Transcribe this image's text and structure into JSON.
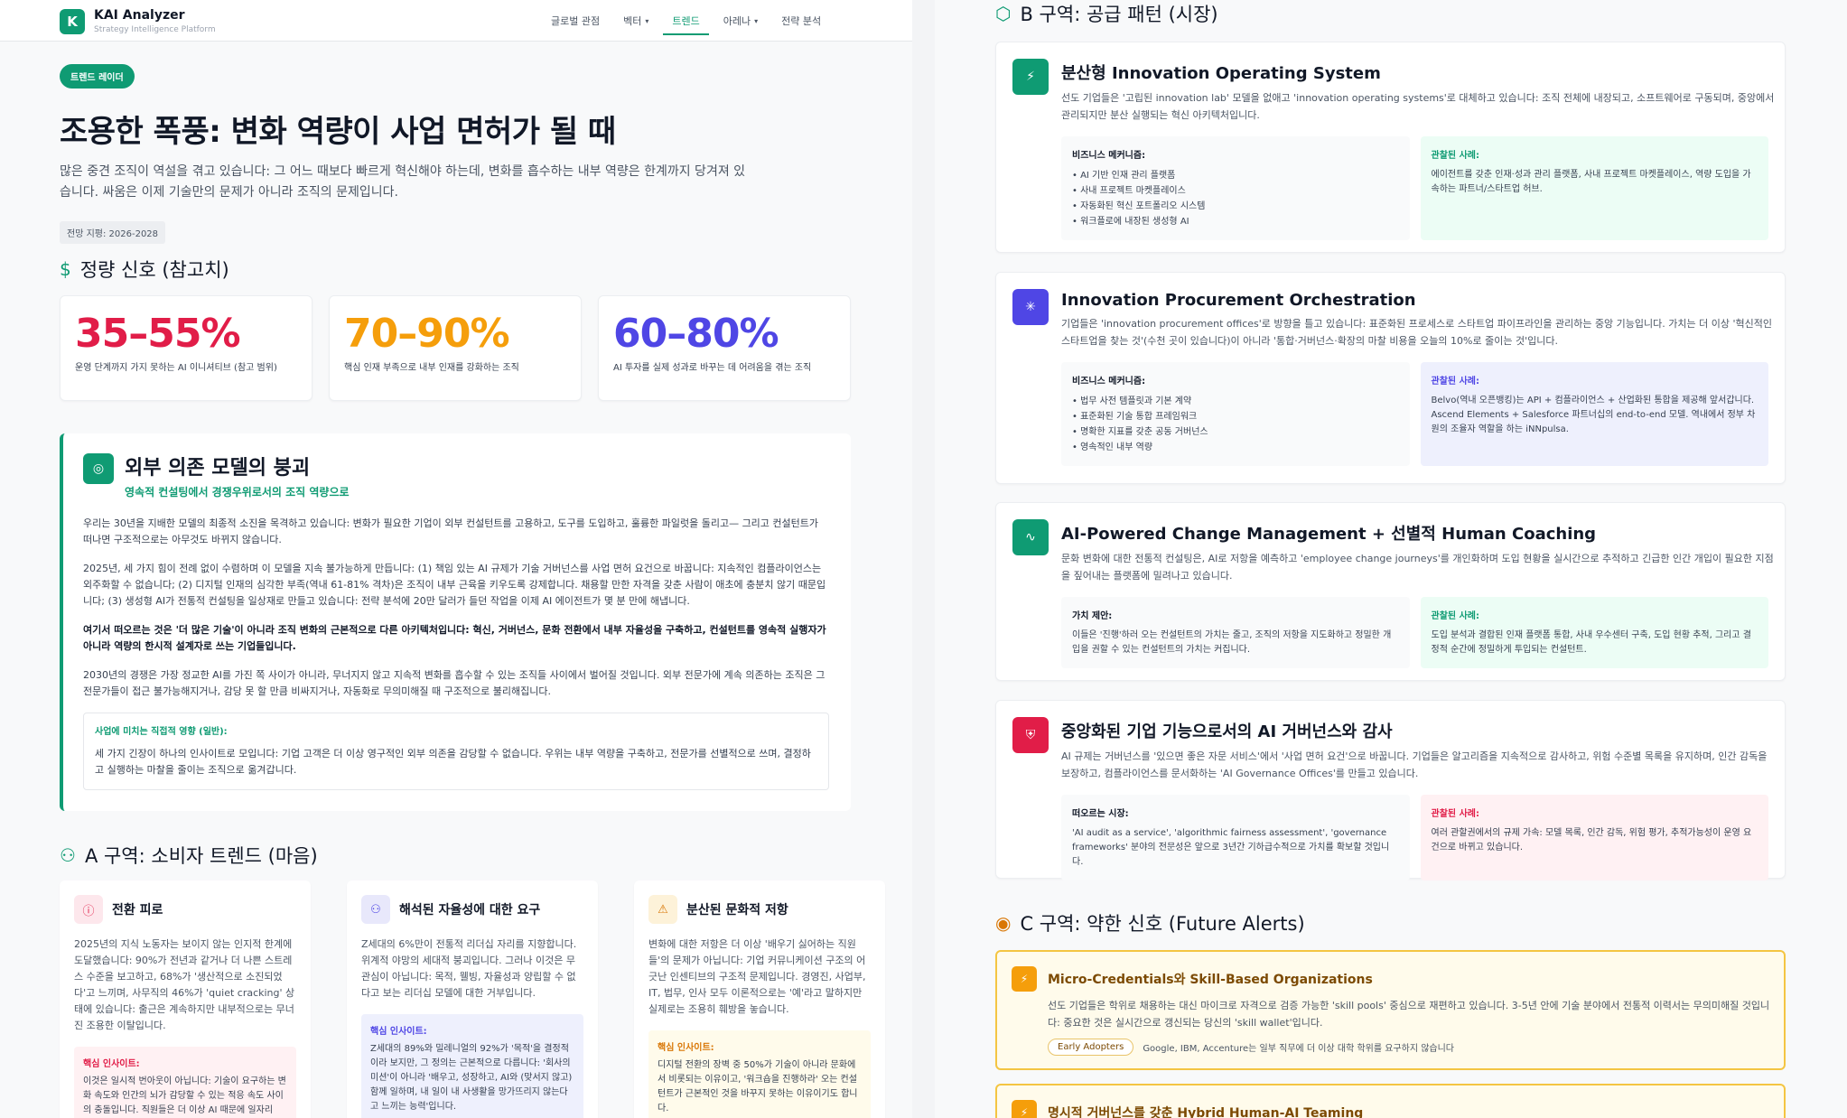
{
  "app": {
    "logo_letter": "K",
    "title": "KAI Analyzer",
    "subtitle": "Strategy Intelligence Platform"
  },
  "nav": {
    "items": [
      {
        "label": "글로벌 관점",
        "dropdown": false,
        "active": false
      },
      {
        "label": "벡터",
        "dropdown": true,
        "active": false
      },
      {
        "label": "트렌드",
        "dropdown": false,
        "active": true
      },
      {
        "label": "아레나",
        "dropdown": true,
        "active": false
      },
      {
        "label": "전략 분석",
        "dropdown": false,
        "active": false
      }
    ]
  },
  "hero": {
    "badge": "트렌드 레이더",
    "title": "조용한 폭풍: 변화 역량이 사업 면허가 될 때",
    "description": "많은 중견 조직이 역설을 겪고 있습니다: 그 어느 때보다 빠르게 혁신해야 하는데, 변화를 흡수하는 내부 역량은 한계까지 당겨져 있습니다. 싸움은 이제 기술만의 문제가 아니라 조직의 문제입니다.",
    "horizon": "전망 지평: 2026-2028"
  },
  "quant": {
    "heading": "정량 신호 (참고치)",
    "metrics": [
      {
        "value": "35–55%",
        "label": "운영 단계까지 가지 못하는 AI 이니셔티브 (참고 범위)",
        "color": "#e11d48"
      },
      {
        "value": "70–90%",
        "label": "핵심 인재 부족으로 내부 인재를 강화하는 조직",
        "color": "#f59e0b"
      },
      {
        "value": "60–80%",
        "label": "AI 투자를 실제 성과로 바꾸는 데 어려움을 겪는 조직",
        "color": "#4f46e5"
      }
    ]
  },
  "collapse": {
    "title": "외부 의존 모델의 붕괴",
    "subtitle": "영속적 컨설팅에서 경쟁우위로서의 조직 역량으로",
    "p1": "우리는 30년을 지배한 모델의 최종적 소진을 목격하고 있습니다: 변화가 필요한 기업이 외부 컨설턴트를 고용하고, 도구를 도입하고, 훌륭한 파일럿을 돌리고— 그리고 컨설턴트가 떠나면 구조적으로는 아무것도 바뀌지 않습니다.",
    "p2": "2025년, 세 가지 힘이 전례 없이 수렴하며 이 모델을 지속 불가능하게 만듭니다: (1) 책임 있는 AI 규제가 기술 거버넌스를 사업 면허 요건으로 바꿉니다: 지속적인 컴플라이언스는 외주화할 수 없습니다; (2) 디지털 인재의 심각한 부족(역내 61-81% 격차)은 조직이 내부 근육을 키우도록 강제합니다. 채용할 만한 자격을 갖춘 사람이 애초에 충분치 않기 때문입니다; (3) 생성형 AI가 전통적 컨설팅을 일상재로 만들고 있습니다: 전략 분석에 20만 달러가 들던 작업을 이제 AI 에이전트가 몇 분 만에 해냅니다.",
    "p3": "여기서 떠오르는 것은 '더 많은 기술'이 아니라 조직 변화의 근본적으로 다른 아키텍처입니다: 혁신, 거버넌스, 문화 전환에서 내부 자율성을 구축하고, 컨설턴트를 영속적 실행자가 아니라 역량의 한시적 설계자로 쓰는 기업들입니다.",
    "p4": "2030년의 경쟁은 가장 정교한 AI를 가진 쪽 사이가 아니라, 무너지지 않고 지속적 변화를 흡수할 수 있는 조직들 사이에서 벌어질 것입니다. 외부 전문가에 계속 의존하는 조직은 그 전문가들이 접근 불가능해지거나, 감당 못 할 만큼 비싸지거나, 자동화로 무의미해질 때 구조적으로 불리해집니다.",
    "impact_title": "사업에 미치는 직접적 영향 (일반):",
    "impact_desc": "세 가지 긴장이 하나의 인사이트로 모입니다: 기업 고객은 더 이상 영구적인 외부 의존을 감당할 수 없습니다. 우위는 내부 역량을 구축하고, 전문가를 선별적으로 쓰며, 결정하고 실행하는 마찰을 줄이는 조직으로 옮겨갑니다."
  },
  "zone_a": {
    "heading": "A 구역: 소비자 트렌드 (마음)",
    "cards": [
      {
        "icon": "alert-circle-icon",
        "title": "전환 피로",
        "desc": "2025년의 지식 노동자는 보이지 않는 인지적 한계에 도달했습니다: 90%가 전년과 같거나 더 나쁜 스트레스 수준을 보고하고, 68%가 '생산적으로 소진되었다'고 느끼며, 사무직의 46%가 'quiet cracking' 상태에 있습니다: 출근은 계속하지만 내부적으로는 무너진 조용한 이탈입니다.",
        "insight_title": "핵심 인사이트:",
        "insight_desc": "이것은 일시적 번아웃이 아닙니다: 기술이 요구하는 변화 속도와 인간의 뇌가 감당할 수 있는 적응 속도 사이의 충돌입니다. 직원들은 더 이상 AI 때문에 일자리"
      },
      {
        "icon": "users-icon",
        "title": "해석된 자율성에 대한 요구",
        "desc": "Z세대의 6%만이 전통적 리더십 자리를 지향합니다. 위계적 야망의 세대적 붕괴입니다. 그러나 이것은 무관심이 아닙니다: 목적, 웰빙, 자율성과 양립할 수 없다고 보는 리더십 모델에 대한 거부입니다.",
        "insight_title": "핵심 인사이트:",
        "insight_desc": "Z세대의 89%와 밀레니얼의 92%가 '목적'을 결정적이라 보지만, 그 정의는 근본적으로 다릅니다: '회사의 미션'이 아니라 '배우고, 성장하고, AI와 (맞서지 않고) 함께 일하며, 내 일이 내 사생활을 망가뜨리지 않는다고 느끼는 능력'입니다."
      },
      {
        "icon": "warning-icon",
        "title": "분산된 문화적 저항",
        "desc": "변화에 대한 저항은 더 이상 '배우기 싫어하는 직원들'의 문제가 아닙니다: 기업 커뮤니케이션 구조의 어긋난 인센티브의 구조적 문제입니다. 경영진, 사업부, IT, 법무, 인사 모두 이론적으로는 '예'라고 말하지만 실제로는 조용히 훼방을 놓습니다.",
        "insight_title": "핵심 인사이트:",
        "insight_desc": "디지털 전환의 장벽 중 50%가 기술이 아니라 문화에서 비롯되는 이유이고, '워크숍을 진행하라' 오는 컨설턴트가 근본적인 것을 바꾸지 못하는 이유이기도 합니다."
      }
    ]
  },
  "zone_b": {
    "heading": "B 구역: 공급 패턴 (시장)",
    "cards": [
      {
        "title": "분산형 Innovation Operating System",
        "desc": "선도 기업들은 '고립된 innovation lab' 모델을 없애고 'innovation operating systems'로 대체하고 있습니다: 조직 전체에 내장되고, 소프트웨어로 구동되며, 중앙에서 관리되지만 분산 실행되는 혁신 아키텍처입니다.",
        "left_title": "비즈니스 메커니즘:",
        "left_items": [
          "AI 기반 인재 관리 플랫폼",
          "사내 프로젝트 마켓플레이스",
          "자동화된 혁신 포트폴리오 시스템",
          "워크플로에 내장된 생성형 AI"
        ],
        "right_title": "관찰된 사례:",
        "right_desc": "에이전트를 갖춘 인재·성과 관리 플랫폼, 사내 프로젝트 마켓플레이스, 역량 도입을 가속하는 파트너/스타트업 허브."
      },
      {
        "title": "Innovation Procurement Orchestration",
        "desc": "기업들은 'innovation procurement offices'로 방향을 틀고 있습니다: 표준화된 프로세스로 스타트업 파이프라인을 관리하는 중앙 기능입니다. 가치는 더 이상 '혁신적인 스타트업을 찾는 것'(수천 곳이 있습니다)이 아니라 '통합·거버넌스·확장의 마찰 비용을 오늘의 10%로 줄이는 것'입니다.",
        "left_title": "비즈니스 메커니즘:",
        "left_items": [
          "법무 사전 템플릿과 기본 계약",
          "표준화된 기술 통합 프레임워크",
          "명확한 지표를 갖춘 공동 거버넌스",
          "영속적인 내부 역량"
        ],
        "right_title": "관찰된 사례:",
        "right_desc": "Belvo(역내 오픈뱅킹)는 API + 컴플라이언스 + 산업화된 통합을 제공해 앞서갑니다. Ascend Elements + Salesforce 파트너십의 end-to-end 모델. 역내에서 정부 차원의 조율자 역할을 하는 iNNpulsa."
      },
      {
        "title": "AI-Powered Change Management + 선별적 Human Coaching",
        "desc": "문화 변화에 대한 전통적 컨설팅은, AI로 저항을 예측하고 'employee change journeys'를 개인화하며 도입 현황을 실시간으로 추적하고 긴급한 인간 개입이 필요한 지점을 짚어내는 플랫폼에 밀려나고 있습니다.",
        "left_title": "가치 제안:",
        "left_desc": "이들은 '진행'하러 오는 컨설턴트의 가치는 줄고, 조직의 저항을 지도화하고 정밀한 개입을 권할 수 있는 컨설턴트의 가치는 커집니다.",
        "right_title": "관찰된 사례:",
        "right_desc": "도입 분석과 결합된 인재 플랫폼 통합, 사내 우수센터 구축, 도입 현황 추적, 그리고 결정적 순간에 정밀하게 투입되는 컨설턴트."
      },
      {
        "title": "중앙화된 기업 기능으로서의 AI 거버넌스와 감사",
        "desc": "AI 규제는 거버넌스를 '있으면 좋은 자문 서비스'에서 '사업 면허 요건'으로 바꿉니다. 기업들은 알고리즘을 지속적으로 감사하고, 위험 수준별 목록을 유지하며, 인간 감독을 보장하고, 컴플라이언스를 문서화하는 'AI Governance Offices'를 만들고 있습니다.",
        "left_title": "떠오르는 시장:",
        "left_desc": "'AI audit as a service', 'algorithmic fairness assessment', 'governance frameworks' 분야의 전문성은 앞으로 3년간 기하급수적으로 가치를 확보할 것입니다.",
        "right_title": "관찰된 사례:",
        "right_desc": "여러 관할권에서의 규제 가속: 모델 목록, 인간 감독, 위험 평가, 추적가능성이 운영 요건으로 바뀌고 있습니다."
      }
    ]
  },
  "zone_c": {
    "heading": "C 구역: 약한 신호 (Future Alerts)",
    "alerts": [
      {
        "title": "Micro-Credentials와 Skill-Based Organizations",
        "desc": "선도 기업들은 학위로 채용하는 대신 마이크로 자격으로 검증 가능한 'skill pools' 중심으로 재편하고 있습니다. 3-5년 안에 기술 분야에서 전통적 이력서는 무의미해질 것입니다: 중요한 것은 실시간으로 갱신되는 당신의 'skill wallet'입니다.",
        "tag": "Early Adopters",
        "note": "Google, IBM, Accenture는 일부 직무에 더 이상 대학 학위를 요구하지 않습니다"
      },
      {
        "title": "명시적 거버넌스를 갖춘 Hybrid Human-AI Teaming"
      }
    ]
  },
  "colors": {
    "brand": "#0f9b73",
    "red": "#e11d48",
    "amber": "#f59e0b",
    "indigo": "#4f46e5"
  }
}
